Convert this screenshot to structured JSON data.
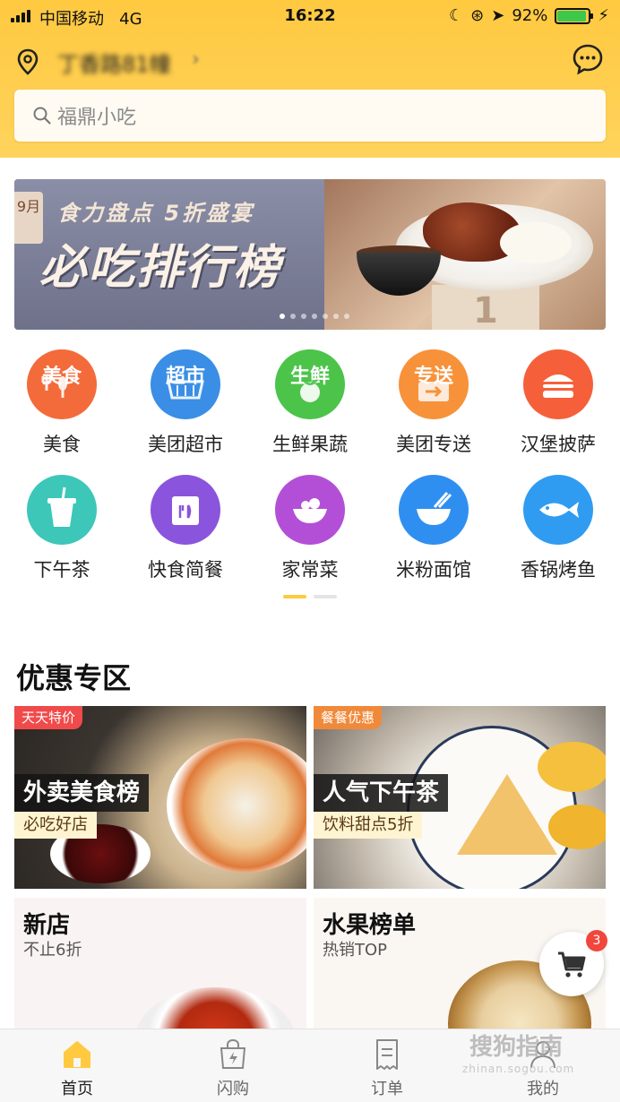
{
  "status_bar": {
    "carrier": "中国移动",
    "network": "4G",
    "time": "16:22",
    "battery": "92%",
    "battery_level": 0.92
  },
  "header": {
    "location": "丁香路81幢",
    "search_placeholder": "福鼎小吃",
    "accent_color": "#ffc940"
  },
  "banner": {
    "month": "9月",
    "subtitle": "食力盘点 5折盛宴",
    "title": "必吃排行榜",
    "podium_number": "1",
    "dots_count": 7,
    "active_dot": 0
  },
  "categories": [
    {
      "label": "美食",
      "icon_text": "美食",
      "icon": "food-icon",
      "color": "#f36b3b"
    },
    {
      "label": "美团超市",
      "icon_text": "超市",
      "icon": "supermarket-icon",
      "color": "#3a8ee6"
    },
    {
      "label": "生鲜果蔬",
      "icon_text": "生鲜",
      "icon": "fresh-produce-icon",
      "color": "#4cc44a"
    },
    {
      "label": "美团专送",
      "icon_text": "专送",
      "icon": "delivery-icon",
      "color": "#f7923a"
    },
    {
      "label": "汉堡披萨",
      "icon_text": "",
      "icon": "burger-icon",
      "color": "#f5603a"
    },
    {
      "label": "下午茶",
      "icon_text": "",
      "icon": "drink-cup-icon",
      "color": "#3cc7b8"
    },
    {
      "label": "快食简餐",
      "icon_text": "",
      "icon": "fast-food-bag-icon",
      "color": "#8a54dc"
    },
    {
      "label": "家常菜",
      "icon_text": "",
      "icon": "home-dish-icon",
      "color": "#b34fd6"
    },
    {
      "label": "米粉面馆",
      "icon_text": "",
      "icon": "noodle-bowl-icon",
      "color": "#2f8ff0"
    },
    {
      "label": "香锅烤鱼",
      "icon_text": "",
      "icon": "fish-icon",
      "color": "#2f9cf2"
    }
  ],
  "promo": {
    "title": "优惠专区",
    "cards": [
      {
        "tag": "天天特价",
        "title": "外卖美食榜",
        "subtitle": "必吃好店"
      },
      {
        "tag": "餐餐优惠",
        "title": "人气下午茶",
        "subtitle": "饮料甜点5折"
      },
      {
        "title": "新店",
        "subtitle": "不止6折"
      },
      {
        "title": "水果榜单",
        "subtitle": "热销TOP"
      }
    ]
  },
  "cart": {
    "badge": "3"
  },
  "tabbar": [
    {
      "label": "首页",
      "icon": "home-icon",
      "active": true
    },
    {
      "label": "闪购",
      "icon": "flash-buy-bag-icon",
      "active": false
    },
    {
      "label": "订单",
      "icon": "order-list-icon",
      "active": false
    },
    {
      "label": "我的",
      "icon": "profile-icon",
      "active": false
    }
  ],
  "watermark": {
    "text": "搜狗指南",
    "sub": "zhinan.sogou.com"
  }
}
